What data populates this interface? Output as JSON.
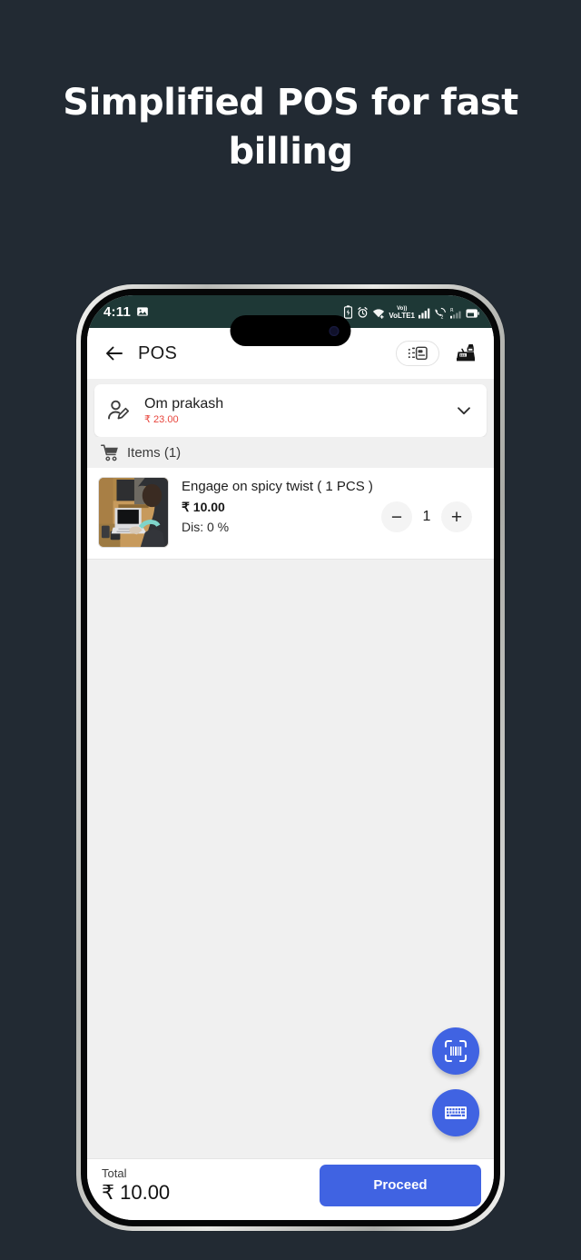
{
  "headline": "Simplified POS for fast billing",
  "theme": {
    "page_background": "#222a33",
    "accent_blue": "#4063e2",
    "due_red": "#e8453c",
    "statusbar_background": "#1e3836"
  },
  "phone": {
    "statusbar": {
      "time": "4:11",
      "left_icons": [
        "image-icon"
      ],
      "right_icons": [
        "battery-saver-icon",
        "alarm-icon",
        "wifi-icon",
        "volte-lte1-icon",
        "signal-bars-icon",
        "call-sim2-icon",
        "roaming-signal-icon",
        "battery-icon"
      ],
      "network_label": "VoLTE1",
      "sim_label": "2",
      "roaming_label": "R"
    },
    "appbar": {
      "back_label": "←",
      "title": "POS",
      "pill_button_icon": "receipt-list-icon",
      "register_button_icon": "cash-register-icon"
    },
    "customer": {
      "icon": "person-edit-icon",
      "name": "Om prakash",
      "due_amount": "₹ 23.00",
      "expand_icon": "chevron-down-icon"
    },
    "items_header": {
      "icon": "cart-icon",
      "label": "Items (1)"
    },
    "items": [
      {
        "thumbnail": "person-at-laptop-photo",
        "name": "Engage on spicy twist ( 1 PCS )",
        "price": "₹ 10.00",
        "discount": "Dis: 0 %",
        "decrement_label": "−",
        "quantity": "1",
        "increment_label": "+"
      }
    ],
    "fabs": [
      {
        "icon": "barcode-scan-icon"
      },
      {
        "icon": "keyboard-icon"
      }
    ],
    "bottom_bar": {
      "total_label": "Total",
      "total_value": "₹ 10.00",
      "proceed_label": "Proceed"
    }
  }
}
